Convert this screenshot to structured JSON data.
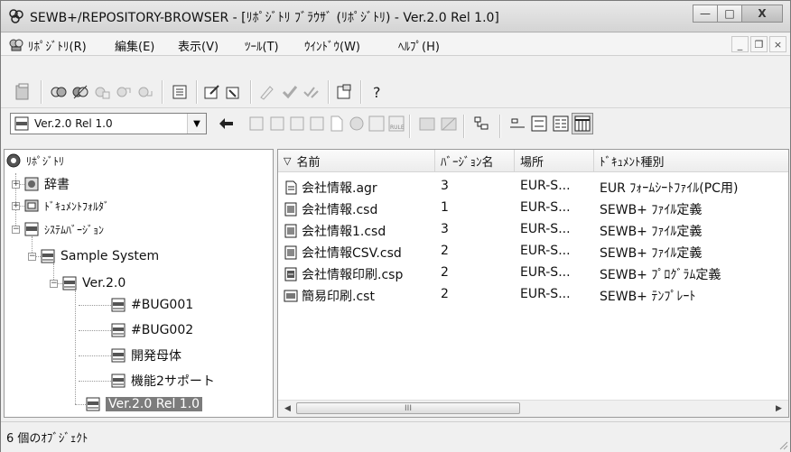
{
  "window": {
    "title": "SEWB+/REPOSITORY-BROWSER - [ﾘﾎﾟｼﾞﾄﾘ ﾌﾞﾗｳｻﾞ (ﾘﾎﾟｼﾞﾄﾘ) - Ver.2.0 Rel 1.0]",
    "controls": {
      "minimize": "—",
      "maximize": "□",
      "close": "X"
    }
  },
  "menubar": {
    "items": [
      "ﾘﾎﾟｼﾞﾄﾘ(R)",
      "編集(E)",
      "表示(V)",
      "ﾂｰﾙ(T)",
      "ｳｲﾝﾄﾞｳ(W)",
      "ﾍﾙﾌﾟ(H)"
    ],
    "mdi_controls": [
      "_",
      "❐",
      "×"
    ]
  },
  "version_combo": {
    "value": "Ver.2.0 Rel 1.0"
  },
  "tree": {
    "root": "ﾘﾎﾟｼﾞﾄﾘ",
    "dictionary": "辞書",
    "document_folder": "ﾄﾞｷｭﾒﾝﾄﾌｫﾙﾀﾞ",
    "system_version": "ｼｽﾃﾑﾊﾞｰｼﾞｮﾝ",
    "system": "Sample System",
    "version": "Ver.2.0",
    "children": [
      "#BUG001",
      "#BUG002",
      "開発母体",
      "機能2サポート"
    ],
    "selected": "Ver.2.0 Rel 1.0"
  },
  "list": {
    "columns": [
      "名前",
      "ﾊﾞｰｼﾞｮﾝ名",
      "場所",
      "ﾄﾞｷｭﾒﾝﾄ種別"
    ],
    "sort_indicator": "▽",
    "rows": [
      {
        "name": "会社情報.agr",
        "version": "3",
        "location": "EUR-S...",
        "type": "EUR ﾌｫｰﾑｼｰﾄﾌｧｲﾙ(PC用)"
      },
      {
        "name": "会社情報.csd",
        "version": "1",
        "location": "EUR-S...",
        "type": "SEWB+ ﾌｧｲﾙ定義"
      },
      {
        "name": "会社情報1.csd",
        "version": "3",
        "location": "EUR-S...",
        "type": "SEWB+ ﾌｧｲﾙ定義"
      },
      {
        "name": "会社情報CSV.csd",
        "version": "2",
        "location": "EUR-S...",
        "type": "SEWB+ ﾌｧｲﾙ定義"
      },
      {
        "name": "会社情報印刷.csp",
        "version": "2",
        "location": "EUR-S...",
        "type": "SEWB+ ﾌﾟﾛｸﾞﾗﾑ定義"
      },
      {
        "name": "簡易印刷.cst",
        "version": "2",
        "location": "EUR-S...",
        "type": "SEWB+ ﾃﾝﾌﾟﾚｰﾄ"
      }
    ],
    "scroll_left": "◀",
    "scroll_right": "▶",
    "thumb_grip": "III"
  },
  "status": {
    "text": "6 個のｵﾌﾞｼﾞｪｸﾄ"
  }
}
